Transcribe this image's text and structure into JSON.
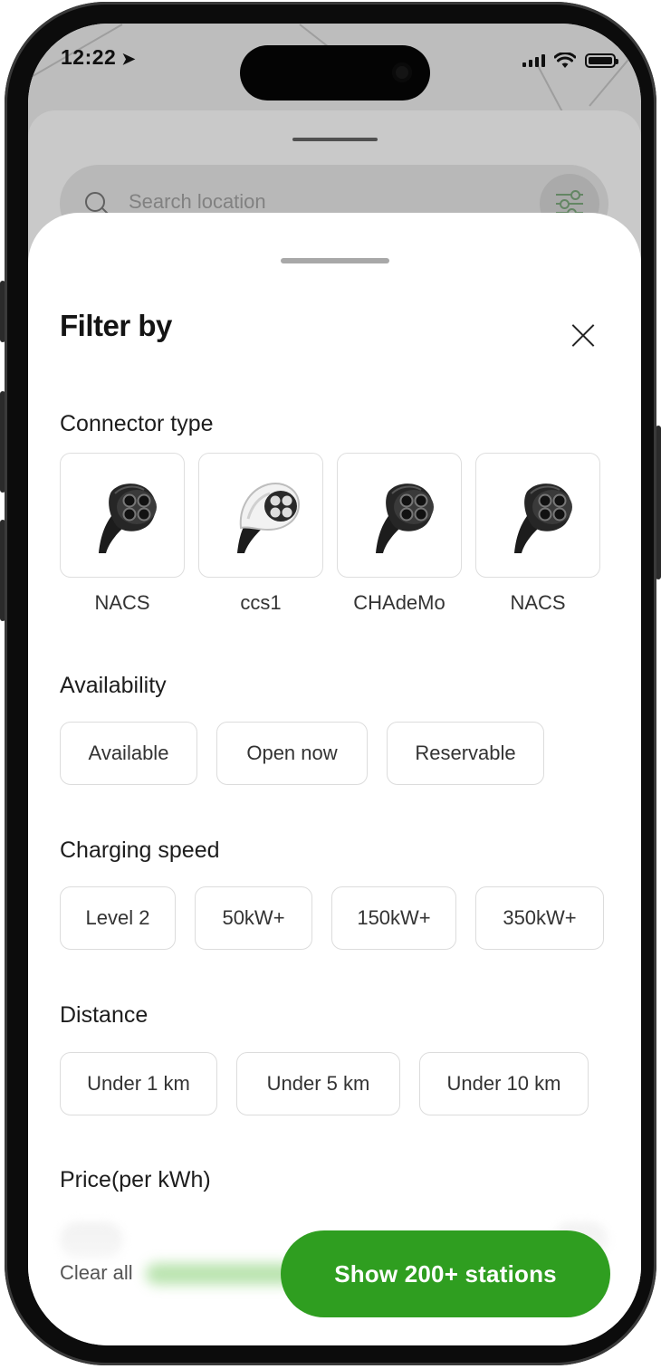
{
  "status_bar": {
    "time": "12:22",
    "location_glyph": "➤",
    "icons": [
      "location-arrow-icon",
      "signal-bars-icon",
      "wifi-icon",
      "battery-icon"
    ]
  },
  "background": {
    "search_placeholder": "Search location"
  },
  "sheet": {
    "title": "Filter by",
    "sections": {
      "connector": {
        "title": "Connector type",
        "options": [
          {
            "label": "NACS",
            "icon": "dark-plug-icon"
          },
          {
            "label": "ccs1",
            "icon": "white-plug-icon"
          },
          {
            "label": "CHAdeMo",
            "icon": "dark-plug-icon"
          },
          {
            "label": "NACS",
            "icon": "dark-plug-icon"
          }
        ]
      },
      "availability": {
        "title": "Availability",
        "options": [
          "Available",
          "Open now",
          "Reservable"
        ]
      },
      "speed": {
        "title": "Charging speed",
        "options": [
          "Level 2",
          "50kW+",
          "150kW+",
          "350kW+"
        ]
      },
      "distance": {
        "title": "Distance",
        "options": [
          "Under 1 km",
          "Under 5 km",
          "Under 10 km"
        ]
      },
      "price": {
        "title": "Price(per kWh)"
      }
    },
    "footer": {
      "clear_label": "Clear all",
      "show_label": "Show 200+  stations"
    }
  },
  "colors": {
    "accent": "#2f9e20",
    "chip_border": "#dcdcdc",
    "text": "#1d1d1d"
  }
}
